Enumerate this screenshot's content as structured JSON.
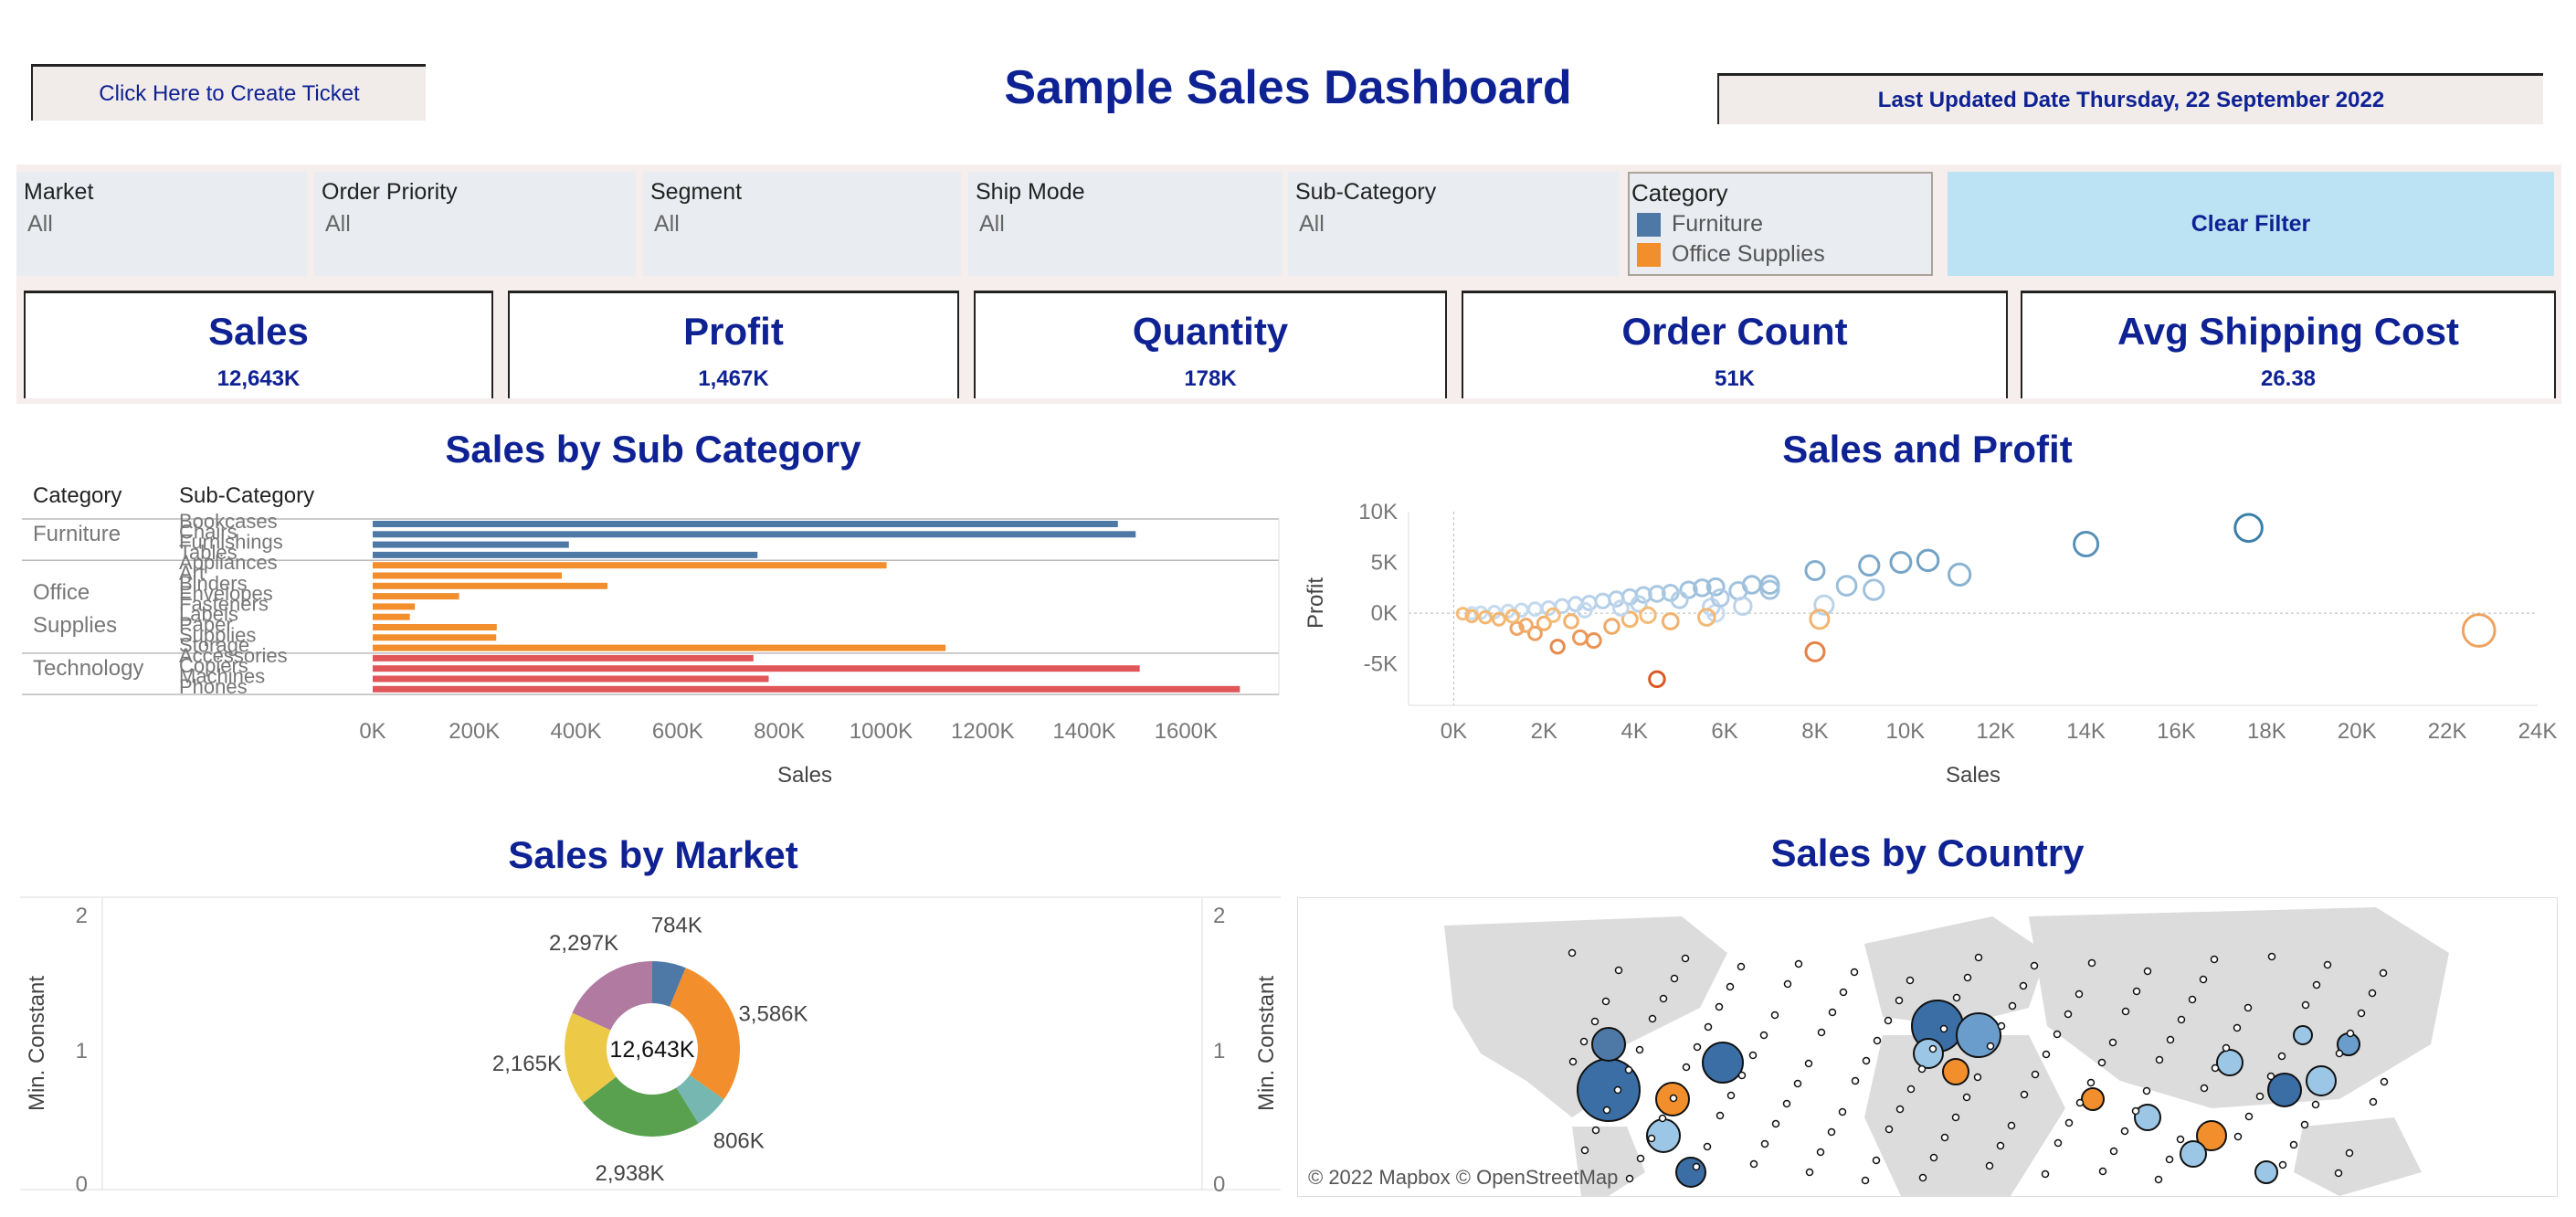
{
  "header": {
    "ticket_button": "Click Here to Create Ticket",
    "title": "Sample Sales Dashboard",
    "last_updated": "Last Updated Date Thursday, 22 September 2022"
  },
  "filters": [
    {
      "label": "Market",
      "value": "All"
    },
    {
      "label": "Order Priority",
      "value": "All"
    },
    {
      "label": "Segment",
      "value": "All"
    },
    {
      "label": "Ship Mode",
      "value": "All"
    },
    {
      "label": "Sub-Category",
      "value": "All"
    }
  ],
  "category_filter": {
    "label": "Category",
    "items": [
      {
        "label": "Furniture",
        "color": "#4e79a7"
      },
      {
        "label": "Office Supplies",
        "color": "#f28e2b"
      }
    ]
  },
  "clear_filter": "Clear Filter",
  "kpis": [
    {
      "label": "Sales",
      "value": "12,643K"
    },
    {
      "label": "Profit",
      "value": "1,467K"
    },
    {
      "label": "Quantity",
      "value": "178K"
    },
    {
      "label": "Order Count",
      "value": "51K"
    },
    {
      "label": "Avg Shipping Cost",
      "value": "26.38"
    }
  ],
  "sections": {
    "sales_by_subcategory": "Sales by Sub Category",
    "sales_and_profit": "Sales and Profit",
    "sales_by_market": "Sales by Market",
    "sales_by_country": "Sales by Country"
  },
  "map_credit": "© 2022 Mapbox © OpenStreetMap",
  "chart_data": [
    {
      "type": "bar",
      "orientation": "horizontal",
      "title": "Sales by Sub Category",
      "xlabel": "Sales",
      "row_headers": [
        "Category",
        "Sub-Category"
      ],
      "xlim": [
        0,
        1700000
      ],
      "x_ticks": [
        "0K",
        "200K",
        "400K",
        "600K",
        "800K",
        "1000K",
        "1200K",
        "1400K",
        "1600K"
      ],
      "groups": [
        {
          "category": "Furniture",
          "color": "#4e79a7",
          "items": [
            {
              "name": "Bookcases",
              "value": 1466000
            },
            {
              "name": "Chairs",
              "value": 1501000
            },
            {
              "name": "Furnishings",
              "value": 386000
            },
            {
              "name": "Tables",
              "value": 757000
            }
          ]
        },
        {
          "category": "Office Supplies",
          "color": "#f28e2b",
          "items": [
            {
              "name": "Appliances",
              "value": 1011000
            },
            {
              "name": "Art",
              "value": 372000
            },
            {
              "name": "Binders",
              "value": 462000
            },
            {
              "name": "Envelopes",
              "value": 170000
            },
            {
              "name": "Fasteners",
              "value": 83000
            },
            {
              "name": "Labels",
              "value": 73000
            },
            {
              "name": "Paper",
              "value": 244000
            },
            {
              "name": "Supplies",
              "value": 243000
            },
            {
              "name": "Storage",
              "value": 1127000
            }
          ]
        },
        {
          "category": "Technology",
          "color": "#e15759",
          "items": [
            {
              "name": "Accessories",
              "value": 749000
            },
            {
              "name": "Copiers",
              "value": 1509000
            },
            {
              "name": "Machines",
              "value": 779000
            },
            {
              "name": "Phones",
              "value": 1706000
            }
          ]
        }
      ]
    },
    {
      "type": "scatter",
      "title": "Sales and Profit",
      "xlabel": "Sales",
      "ylabel": "Profit",
      "xlim": [
        -1000,
        24000
      ],
      "ylim": [
        -8000,
        10000
      ],
      "x_ticks": [
        "0K",
        "2K",
        "4K",
        "6K",
        "8K",
        "10K",
        "12K",
        "14K",
        "16K",
        "18K",
        "20K",
        "22K",
        "24K"
      ],
      "y_ticks": [
        "10K",
        "5K",
        "0K",
        "-5K"
      ],
      "y_tick_values": [
        10000,
        5000,
        0,
        -5000
      ],
      "points": [
        [
          17600,
          8400
        ],
        [
          14000,
          6800
        ],
        [
          22700,
          -1700
        ],
        [
          11200,
          3800
        ],
        [
          10500,
          5200
        ],
        [
          9900,
          5000
        ],
        [
          9200,
          4700
        ],
        [
          8000,
          4200
        ],
        [
          8700,
          2700
        ],
        [
          9300,
          2300
        ],
        [
          7000,
          2800
        ],
        [
          7000,
          2300
        ],
        [
          6600,
          2800
        ],
        [
          6300,
          2200
        ],
        [
          5800,
          2600
        ],
        [
          5500,
          2500
        ],
        [
          5200,
          2300
        ],
        [
          4800,
          2000
        ],
        [
          4500,
          1900
        ],
        [
          4200,
          1800
        ],
        [
          3900,
          1600
        ],
        [
          3600,
          1400
        ],
        [
          3300,
          1200
        ],
        [
          3000,
          1000
        ],
        [
          2700,
          900
        ],
        [
          2400,
          700
        ],
        [
          2100,
          500
        ],
        [
          1800,
          400
        ],
        [
          1500,
          300
        ],
        [
          1200,
          200
        ],
        [
          900,
          100
        ],
        [
          600,
          50
        ],
        [
          400,
          0
        ],
        [
          200,
          -50
        ],
        [
          5700,
          600
        ],
        [
          5800,
          0
        ],
        [
          8200,
          800
        ],
        [
          8100,
          -600
        ],
        [
          8000,
          -3800
        ],
        [
          4500,
          -6500
        ],
        [
          3100,
          -2700
        ],
        [
          2800,
          -2400
        ],
        [
          2300,
          -3300
        ],
        [
          1800,
          -2000
        ],
        [
          1400,
          -1500
        ],
        [
          2000,
          -1000
        ],
        [
          2600,
          -800
        ],
        [
          3500,
          -1300
        ],
        [
          3900,
          -600
        ],
        [
          4800,
          -800
        ],
        [
          5600,
          -400
        ],
        [
          1000,
          -600
        ],
        [
          700,
          -400
        ],
        [
          400,
          -300
        ],
        [
          1600,
          -1200
        ],
        [
          2900,
          300
        ],
        [
          4100,
          900
        ],
        [
          5000,
          1300
        ],
        [
          5900,
          1500
        ],
        [
          3700,
          500
        ],
        [
          6400,
          700
        ],
        [
          4300,
          -200
        ],
        [
          2200,
          -200
        ],
        [
          1300,
          -300
        ]
      ]
    },
    {
      "type": "pie",
      "donut": true,
      "title": "Sales by Market",
      "ylabel": "Min. Constant",
      "y_ticks": [
        "2",
        "1",
        "0"
      ],
      "center_label": "12,643K",
      "slices": [
        {
          "label": "784K",
          "value": 784,
          "color": "#4e79a7"
        },
        {
          "label": "3,586K",
          "value": 3586,
          "color": "#f28e2b"
        },
        {
          "label": "806K",
          "value": 806,
          "color": "#76b7b2"
        },
        {
          "label": "2,938K",
          "value": 2938,
          "color": "#59a14f"
        },
        {
          "label": "2,165K",
          "value": 2165,
          "color": "#edc948"
        },
        {
          "label": "2,297K",
          "value": 2297,
          "color": "#b07aa1"
        }
      ]
    }
  ]
}
